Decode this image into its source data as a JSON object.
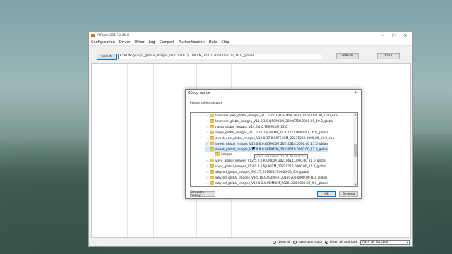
{
  "window": {
    "title": "MiFlash 2017.2.26.0",
    "menu": [
      "Configuration",
      "Driver",
      "Other",
      "Log",
      "Comport",
      "Authentication",
      "Help",
      "Chip"
    ],
    "select_label": "select",
    "path_value": "E:\\ROM\\ginkgo_global_images_V12.0.4.0.QCOMIXM_20210300.0000.00_10.0_global",
    "refresh_label": "refresh",
    "flash_label": "flash"
  },
  "statusbar": {
    "options": [
      {
        "label": "clean all",
        "selected": false
      },
      {
        "label": "save user data",
        "selected": false
      },
      {
        "label": "clean all and lock",
        "selected": true
      }
    ],
    "script": "flash_all_lock.bat"
  },
  "dialog": {
    "title": "Обзор папок",
    "prompt": "Please select sw path",
    "folders": [
      {
        "label": "lavender_eea_global_images_V12.0.2.0.QFGEUXM_20201016.0000.00_10.0_eea",
        "expanded": false
      },
      {
        "label": "lavender_global_images_V11.0.1.0.QFGMIXM_20200714.0000.00_10.0_global",
        "expanded": false
      },
      {
        "label": "natsu_global_images_V14.0.4.0.TKMMIXM_13.0",
        "expanded": false
      },
      {
        "label": "surya_global_images_V12.0.7.0.QJGMIXM_20201221.0000.00_10.0_global",
        "expanded": false
      },
      {
        "label": "sweet_eea_global_images_V13.0.17.0.SKFEUXM_20231229.0000.00_12.0_eea",
        "expanded": false
      },
      {
        "label": "sweet_global_images_V12.0.6.0.RKFMIXM_20210314.0000.00_11.0_global",
        "expanded": false
      },
      {
        "label": "sweet_global_images_V12.0.8.0.SKFMIXM_20230218.0000.00_12.0_global",
        "expanded": true
      },
      {
        "label": "images",
        "child": true
      },
      {
        "label": "vayu_global_images_V12.5.2.0.RJUMIXM_20210611.0000.00_11.0_global",
        "expanded": false
      },
      {
        "label": "vayu_global_images_V13.0.3.0.SJUMIXM_20220226.0000.00_12.0_global",
        "expanded": false
      },
      {
        "label": "whyred_global_images_9.6.27_20190627.0000.00_9.0_global",
        "expanded": false
      },
      {
        "label": "whyred_global_images_V9.5.19.0.OEIMIFA_20180706.0000.00_8.1_global",
        "expanded": false
      },
      {
        "label": "whyred_global_images_V12.0.2.0.PEIMIXM_20201224.0000.00_9.0_global",
        "expanded": false
      }
    ],
    "tooltip": "Дата создания: 30.03.2023 21:55",
    "new_folder_label": "Создать папку",
    "ok_label": "OK",
    "cancel_label": "Отмена"
  }
}
